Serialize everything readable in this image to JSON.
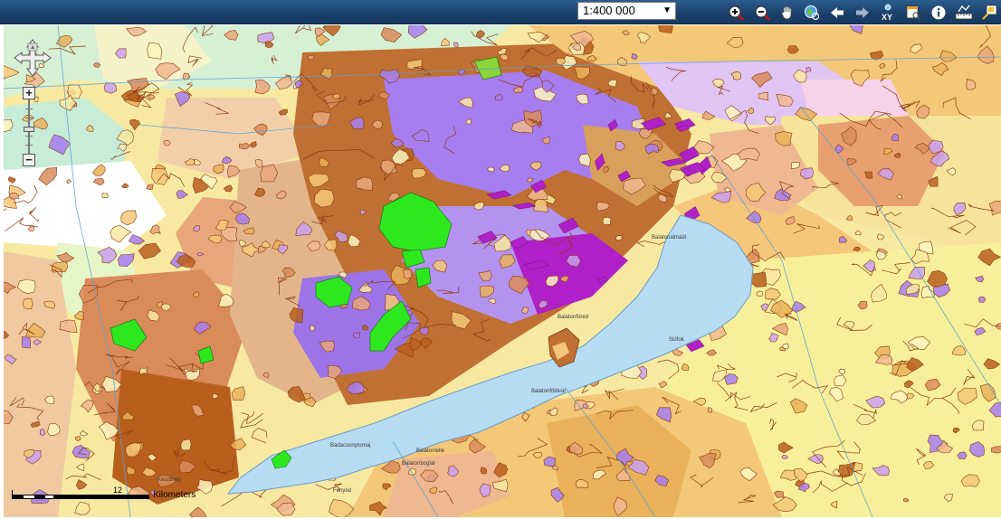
{
  "toolbar": {
    "scale_select": {
      "value": "1:400 000"
    },
    "tools": [
      {
        "name": "zoom-in-icon"
      },
      {
        "name": "zoom-out-icon"
      },
      {
        "name": "pan-hand-icon"
      },
      {
        "name": "full-extent-globe-icon"
      },
      {
        "name": "back-arrow-icon"
      },
      {
        "name": "forward-arrow-icon"
      },
      {
        "name": "xy-coordinate-icon"
      },
      {
        "name": "query-window-icon"
      },
      {
        "name": "info-icon"
      },
      {
        "name": "measure-ruler-icon"
      },
      {
        "name": "overview-map-icon"
      }
    ]
  },
  "map": {
    "scalebar": {
      "tick_label": "12",
      "unit": "Kilometers"
    },
    "place_labels": [
      "Balatonalmádi",
      "Balatonfüred",
      "Siófok",
      "Balatonföldvár",
      "Badacsonytomaj",
      "Balatonlelle",
      "Balatonboglár",
      "Keszthely",
      "Fonyód"
    ]
  },
  "colors": {
    "toolbar": "#1f4a78",
    "lake": "#b5dcf3",
    "loess": "#f7e9a1",
    "sand": "#fbf6c0",
    "brown": "#b85f1e",
    "purple": "#a67ef0",
    "magenta": "#b020c8",
    "green": "#2ee81f"
  }
}
